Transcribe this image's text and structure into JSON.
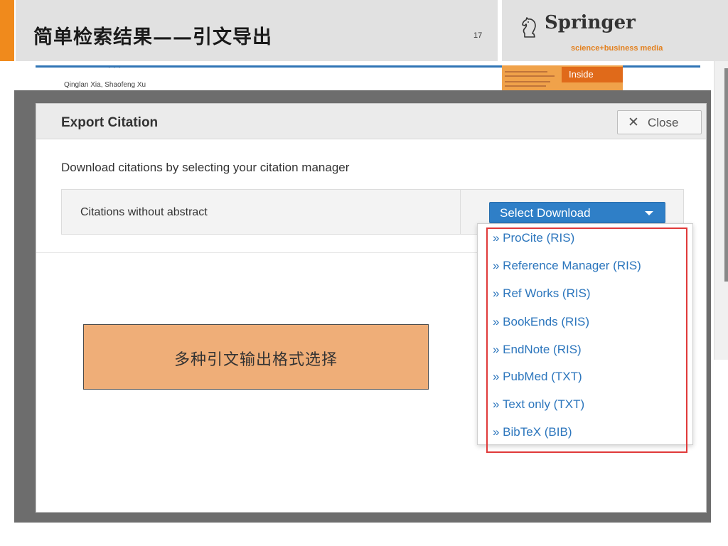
{
  "slide": {
    "title": "简单检索结果——引文导出",
    "number": "17",
    "logo": {
      "name": "Springer",
      "tagline": "science+business media",
      "icon": "knight-horse-icon"
    }
  },
  "webpage": {
    "title_fragment": "…",
    "authors": "Qinglan Xia, Shaofeng Xu",
    "inside_label": "Inside"
  },
  "modal": {
    "title": "Export Citation",
    "close_label": "Close",
    "close_icon": "close-x-icon",
    "instruction": "Download citations by selecting your citation manager",
    "row_label": "Citations without abstract",
    "select_label": "Select Download",
    "options": [
      "» ProCite (RIS)",
      "» Reference Manager (RIS)",
      "» Ref Works (RIS)",
      "» BookEnds (RIS)",
      "» EndNote (RIS)",
      "» PubMed (TXT)",
      "» Text only (TXT)",
      "» BibTeX (BIB)"
    ]
  },
  "callout": {
    "text": "多种引文输出格式选择"
  },
  "colors": {
    "accent": "#f08a1c",
    "link": "#2c76bd",
    "button": "#2f7fc7",
    "highlight": "#e03a3a",
    "callout": "#efae78"
  }
}
